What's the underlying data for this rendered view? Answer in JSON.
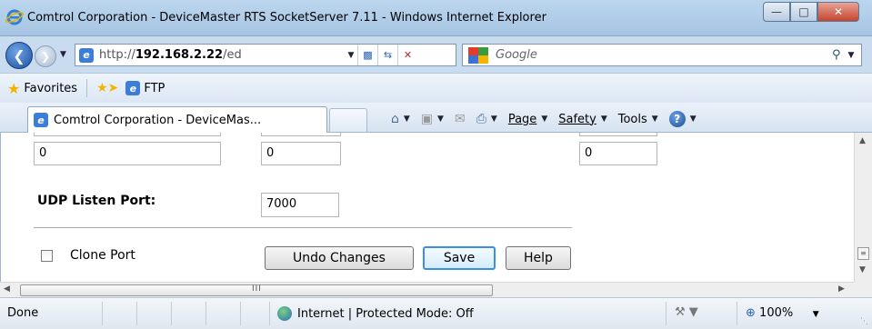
{
  "window": {
    "title": "Comtrol Corporation - DeviceMaster RTS SocketServer 7.11 - Windows Internet Explorer",
    "minimize_icon": "minimize-icon",
    "maximize_icon": "maximize-icon",
    "close_icon": "close-icon"
  },
  "address_bar": {
    "url_prefix": "http://",
    "url_host": "192.168.2.22",
    "url_suffix": "/ed",
    "search_placeholder": "Google"
  },
  "favorites_bar": {
    "favorites_label": "Favorites",
    "ftp_label": "FTP"
  },
  "tabs": [
    {
      "title": "Comtrol Corporation - DeviceMas..."
    }
  ],
  "command_bar": {
    "page_label": "Page",
    "safety_label": "Safety",
    "tools_label": "Tools"
  },
  "form": {
    "row_values": [
      "0",
      "0",
      "0"
    ],
    "udp_listen_port_label": "UDP Listen Port:",
    "udp_listen_port_value": "7000",
    "clone_port_label": "Clone Port",
    "clone_port_checked": false,
    "undo_button": "Undo Changes",
    "save_button": "Save",
    "help_button": "Help"
  },
  "scrollbars": {
    "h_grip": "III"
  },
  "status_bar": {
    "status_text": "Done",
    "zone_text": "Internet | Protected Mode: Off",
    "zoom_text": "100%"
  },
  "colors": {
    "title_bar": "#bcd6ee",
    "close_button": "#c4452f",
    "primary_button_border": "#3a8ee6"
  }
}
